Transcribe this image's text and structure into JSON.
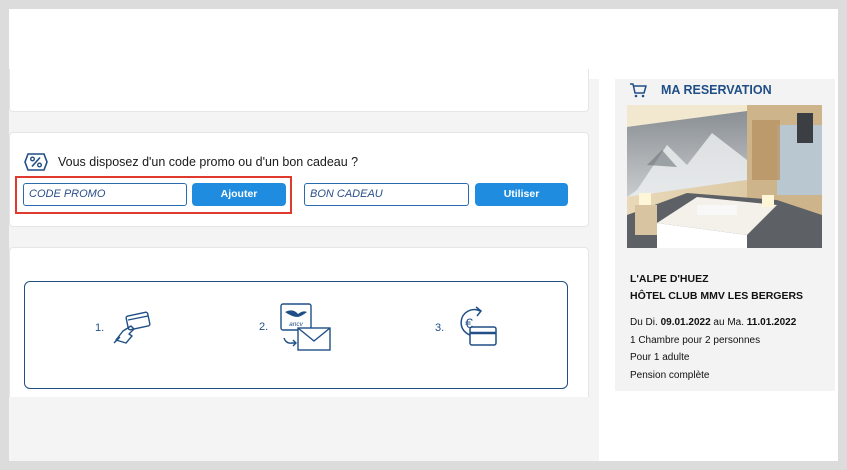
{
  "promo": {
    "question": "Vous disposez d'un code promo ou d'un bon cadeau ?",
    "promo_placeholder": "CODE PROMO",
    "promo_button": "Ajouter",
    "gift_placeholder": "BON CADEAU",
    "gift_button": "Utiliser",
    "icon": "percent-tag-icon"
  },
  "steps": [
    {
      "number": "1.",
      "icon": "card-payment-icon"
    },
    {
      "number": "2.",
      "icon": "ancv-cheque-mail-icon",
      "logo_text": "ancv"
    },
    {
      "number": "3.",
      "icon": "euro-refund-card-icon"
    }
  ],
  "reservation": {
    "title": "MA RESERVATION",
    "icon": "cart-icon",
    "location": "L'ALPE D'HUEZ",
    "hotel": "HÔTEL CLUB MMV LES BERGERS",
    "date_prefix": "Du Di.",
    "date_from": "09.01.2022",
    "date_mid": "au Ma.",
    "date_to": "11.01.2022",
    "room": "1 Chambre pour 2 personnes",
    "guests": "Pour 1 adulte",
    "board": "Pension complète"
  },
  "colors": {
    "brand_blue": "#1f4f86",
    "button_blue": "#1f8ce0",
    "highlight_red": "#e03a2f"
  }
}
